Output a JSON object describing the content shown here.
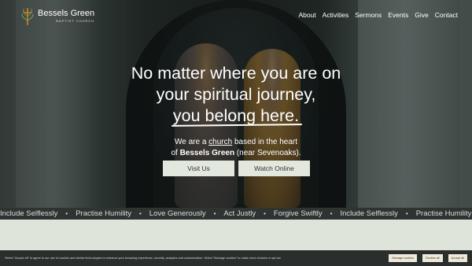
{
  "brand": {
    "name": "Bessels Green",
    "subtitle": "BAPTIST CHURCH"
  },
  "nav": {
    "items": [
      "About",
      "Activities",
      "Sermons",
      "Events",
      "Give",
      "Contact"
    ]
  },
  "hero": {
    "line1": "No matter where you are on",
    "line2": "your spiritual journey,",
    "line3": "you belong here.",
    "sub_prefix": "We are a ",
    "sub_link": "church",
    "sub_after": " based in the heart",
    "sub_of": "of ",
    "sub_bold": "Bessels Green",
    "sub_end": " (near Sevenoaks).",
    "btn_visit": "Visit Us",
    "btn_watch": "Watch Online"
  },
  "ticker": {
    "items": [
      "Include Selflessly",
      "Practise Humility",
      "Love Generously",
      "Act Justly",
      "Forgive Swiftly",
      "Include Selflessly",
      "Practise Humility"
    ],
    "separator": "•"
  },
  "cookie": {
    "text": "Select \"Accept all\" to agree to our use of cookies and similar technologies to enhance your browsing experience, security, analytics and customization. Select \"Manage cookies\" to make more choices or opt out.",
    "manage": "Manage cookies",
    "decline": "Decline all",
    "accept": "Accept all"
  },
  "colors": {
    "accent_green": "#5b8c3a",
    "accent_orange": "#d97a2b",
    "button_bg": "#e3e8df",
    "ticker_bg": "#2f3433",
    "page_bg": "#dfe4da"
  }
}
